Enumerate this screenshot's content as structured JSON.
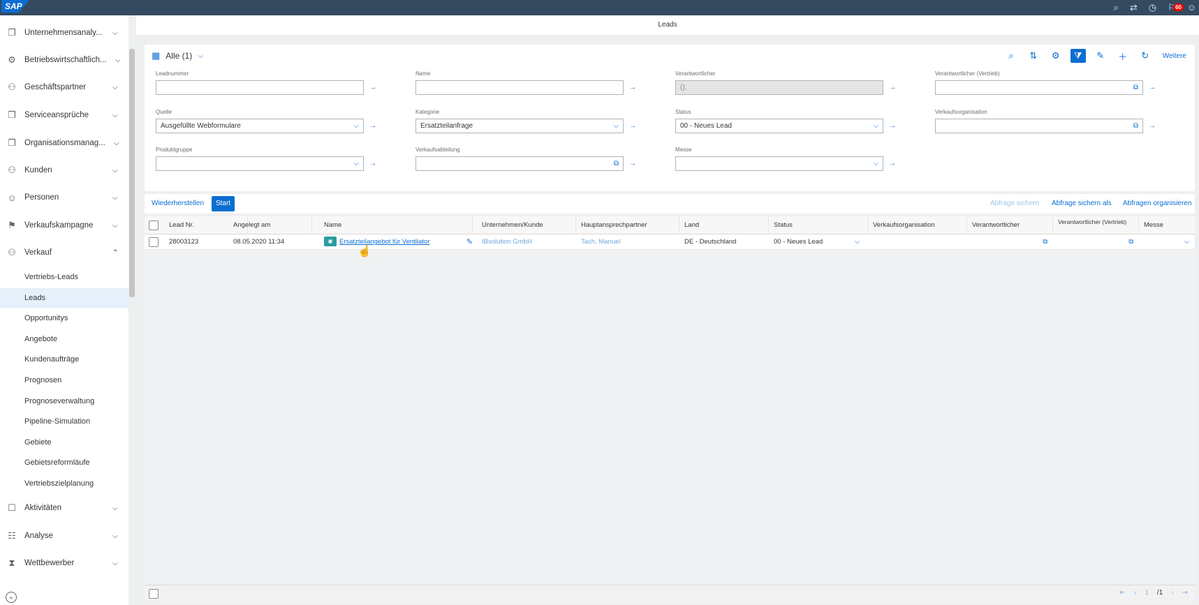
{
  "shell": {
    "logo": "SAP",
    "notification_count": "60"
  },
  "sidebar": {
    "items": [
      {
        "label": "Unternehmensanaly...",
        "icon": "analytics-icon"
      },
      {
        "label": "Betriebswirtschaftlich...",
        "icon": "business-icon"
      },
      {
        "label": "Geschäftspartner",
        "icon": "partner-icon"
      },
      {
        "label": "Serviceansprüche",
        "icon": "service-icon"
      },
      {
        "label": "Organisationsmanag...",
        "icon": "org-icon"
      },
      {
        "label": "Kunden",
        "icon": "customer-icon"
      },
      {
        "label": "Personen",
        "icon": "person-icon"
      },
      {
        "label": "Verkaufskampagne",
        "icon": "campaign-icon"
      },
      {
        "label": "Verkauf",
        "icon": "sales-icon"
      }
    ],
    "sub_items": [
      "Vertriebs-Leads",
      "Leads",
      "Opportunitys",
      "Angebote",
      "Kundenaufträge",
      "Prognosen",
      "Prognoseverwaltung",
      "Pipeline-Simulation",
      "Gebiete",
      "Gebietsreformläufe",
      "Vertriebszielplanung"
    ],
    "bottom_items": [
      {
        "label": "Aktivitäten",
        "icon": "activity-icon"
      },
      {
        "label": "Analyse",
        "icon": "analysis-icon"
      },
      {
        "label": "Wettbewerber",
        "icon": "competitor-icon"
      }
    ]
  },
  "page": {
    "title": "Leads"
  },
  "filter": {
    "variant": "Alle  (1)",
    "more": "Weitere",
    "fields": {
      "leadnummer": {
        "label": "Leadnummer",
        "value": ""
      },
      "name": {
        "label": "Name",
        "value": ""
      },
      "verantwortlicher": {
        "label": "Verantwortlicher",
        "value": "();"
      },
      "verantwortlicher_vertrieb": {
        "label": "Verantwortlicher (Vertrieb)",
        "value": ""
      },
      "quelle": {
        "label": "Quelle",
        "value": "Ausgefüllte Webformulare"
      },
      "kategorie": {
        "label": "Kategorie",
        "value": "Ersatzteilanfrage"
      },
      "status": {
        "label": "Status",
        "value": "00 - Neues Lead"
      },
      "verkaufsorganisation": {
        "label": "Verkaufsorganisation",
        "value": ""
      },
      "produktgruppe": {
        "label": "Produktgruppe",
        "value": ""
      },
      "verkaufsabteilung": {
        "label": "Verkaufsabteilung",
        "value": ""
      },
      "messe": {
        "label": "Messe",
        "value": ""
      }
    },
    "actions": {
      "reset": "Wiederherstellen",
      "start": "Start",
      "save_query": "Abfrage sichern",
      "save_query_as": "Abfrage sichern als",
      "organize_queries": "Abfragen organisieren"
    }
  },
  "table": {
    "columns": [
      "Lead Nr.",
      "Angelegt am",
      "Name",
      "Unternehmen/Kunde",
      "Hauptansprechpartner",
      "Land",
      "Status",
      "Verkaufsorganisation",
      "Verantwortlicher",
      "Verantwortlicher (Vertrieb)",
      "Messe"
    ],
    "rows": [
      {
        "lead_nr": "28003123",
        "created": "08.05.2020 11:34",
        "name": "Ersatzteilangebot für Ventilator",
        "company": "IBsolution GmbH",
        "contact": "Tach, Manuel",
        "country": "DE - Deutschland",
        "status": "00 - Neues Lead"
      }
    ]
  },
  "footer": {
    "page_current": "1",
    "page_total": "/1"
  }
}
